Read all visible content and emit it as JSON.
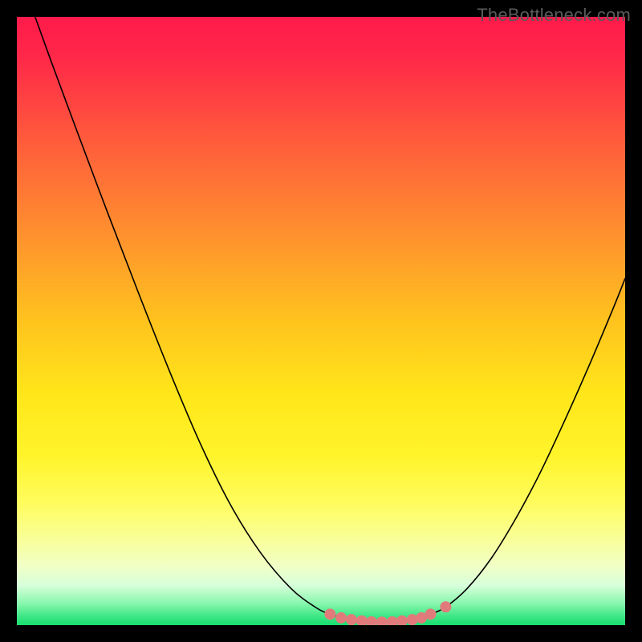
{
  "watermark": {
    "text": "TheBottleneck.com"
  },
  "chart_data": {
    "type": "line",
    "title": "",
    "xlabel": "",
    "ylabel": "",
    "xlim": [
      0,
      100
    ],
    "ylim": [
      0,
      100
    ],
    "grid": false,
    "legend": false,
    "background": {
      "type": "vertical-gradient",
      "stops": [
        {
          "offset": 0.0,
          "color": "#ff1a4b"
        },
        {
          "offset": 0.07,
          "color": "#ff2948"
        },
        {
          "offset": 0.2,
          "color": "#ff5a3c"
        },
        {
          "offset": 0.35,
          "color": "#ff8e2f"
        },
        {
          "offset": 0.5,
          "color": "#ffc31e"
        },
        {
          "offset": 0.62,
          "color": "#ffe61a"
        },
        {
          "offset": 0.72,
          "color": "#fff42a"
        },
        {
          "offset": 0.8,
          "color": "#fffc5e"
        },
        {
          "offset": 0.86,
          "color": "#f8ff9a"
        },
        {
          "offset": 0.905,
          "color": "#f0ffc8"
        },
        {
          "offset": 0.935,
          "color": "#d6ffda"
        },
        {
          "offset": 0.965,
          "color": "#86f6ac"
        },
        {
          "offset": 0.985,
          "color": "#3fe786"
        },
        {
          "offset": 1.0,
          "color": "#17df6e"
        }
      ]
    },
    "series": [
      {
        "name": "bottleneck-curve",
        "color": "#000000",
        "width": 1.6,
        "points": [
          {
            "x": 3.0,
            "y": 100.0
          },
          {
            "x": 6.0,
            "y": 91.7
          },
          {
            "x": 10.0,
            "y": 80.9
          },
          {
            "x": 15.0,
            "y": 67.6
          },
          {
            "x": 20.0,
            "y": 54.6
          },
          {
            "x": 25.0,
            "y": 42.0
          },
          {
            "x": 30.0,
            "y": 30.2
          },
          {
            "x": 35.0,
            "y": 20.0
          },
          {
            "x": 40.0,
            "y": 12.0
          },
          {
            "x": 45.0,
            "y": 6.1
          },
          {
            "x": 49.0,
            "y": 3.0
          },
          {
            "x": 51.5,
            "y": 1.8
          },
          {
            "x": 55.0,
            "y": 0.9
          },
          {
            "x": 60.0,
            "y": 0.5
          },
          {
            "x": 65.0,
            "y": 0.9
          },
          {
            "x": 68.0,
            "y": 1.8
          },
          {
            "x": 70.5,
            "y": 3.0
          },
          {
            "x": 74.0,
            "y": 6.0
          },
          {
            "x": 78.0,
            "y": 11.0
          },
          {
            "x": 82.0,
            "y": 17.5
          },
          {
            "x": 86.0,
            "y": 25.0
          },
          {
            "x": 90.0,
            "y": 33.5
          },
          {
            "x": 94.0,
            "y": 42.5
          },
          {
            "x": 98.0,
            "y": 52.0
          },
          {
            "x": 100.0,
            "y": 57.0
          }
        ]
      }
    ],
    "markers": {
      "name": "highlight-band",
      "color": "#e17b7b",
      "radius_px": 7,
      "points": [
        {
          "x": 51.5,
          "y": 1.8
        },
        {
          "x": 53.3,
          "y": 1.2
        },
        {
          "x": 55.0,
          "y": 0.9
        },
        {
          "x": 56.7,
          "y": 0.7
        },
        {
          "x": 58.3,
          "y": 0.55
        },
        {
          "x": 60.0,
          "y": 0.5
        },
        {
          "x": 61.7,
          "y": 0.55
        },
        {
          "x": 63.3,
          "y": 0.7
        },
        {
          "x": 65.0,
          "y": 0.9
        },
        {
          "x": 66.5,
          "y": 1.2
        },
        {
          "x": 68.0,
          "y": 1.8
        },
        {
          "x": 70.5,
          "y": 3.0
        }
      ]
    }
  }
}
